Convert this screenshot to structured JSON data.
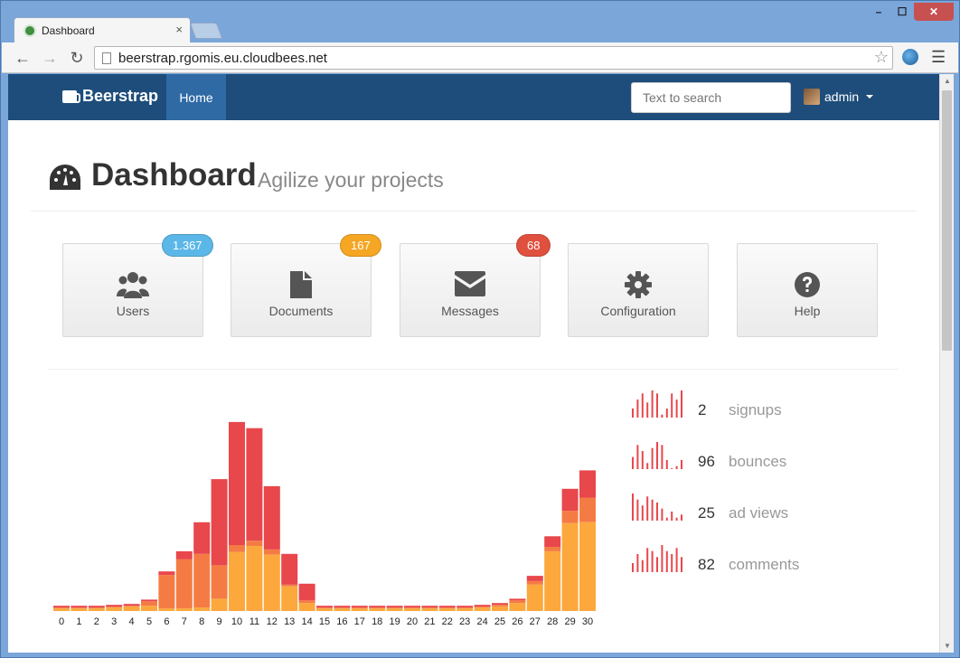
{
  "browser": {
    "tab_title": "Dashboard",
    "tab_close": "×",
    "url": "beerstrap.rgomis.eu.cloudbees.net",
    "window_controls": [
      "–",
      "☐",
      "✕"
    ]
  },
  "navbar": {
    "brand": "Beerstrap",
    "home_label": "Home",
    "search_placeholder": "Text to search",
    "user_name": "admin",
    "color": "#1e4d7b",
    "active_color": "#2f6aa5"
  },
  "header": {
    "title": "Dashboard",
    "subtitle": "Agilize your projects"
  },
  "tiles": [
    {
      "label": "Users",
      "icon": "users-icon",
      "badge": "1.367",
      "badge_color": "#5bb7e8"
    },
    {
      "label": "Documents",
      "icon": "document-icon",
      "badge": "167",
      "badge_color": "#f5a623"
    },
    {
      "label": "Messages",
      "icon": "envelope-icon",
      "badge": "68",
      "badge_color": "#e0503e"
    },
    {
      "label": "Configuration",
      "icon": "gear-icon",
      "badge": "",
      "badge_color": ""
    },
    {
      "label": "Help",
      "icon": "question-icon",
      "badge": "",
      "badge_color": ""
    }
  ],
  "stats": [
    {
      "value": "2",
      "label": "signups",
      "spark": [
        6,
        12,
        16,
        10,
        18,
        16,
        2,
        6,
        16,
        12,
        18
      ]
    },
    {
      "value": "96",
      "label": "bounces",
      "spark": [
        8,
        16,
        12,
        4,
        14,
        18,
        16,
        6,
        0,
        2,
        6
      ]
    },
    {
      "value": "25",
      "label": "ad views",
      "spark": [
        18,
        14,
        10,
        16,
        14,
        12,
        8,
        2,
        6,
        2,
        4
      ]
    },
    {
      "value": "82",
      "label": "comments",
      "spark": [
        6,
        12,
        8,
        16,
        14,
        10,
        18,
        14,
        12,
        16,
        10
      ]
    }
  ],
  "chart_data": {
    "type": "bar",
    "stacked": true,
    "categories": [
      "0",
      "1",
      "2",
      "3",
      "4",
      "5",
      "6",
      "7",
      "8",
      "9",
      "10",
      "11",
      "12",
      "13",
      "14",
      "15",
      "16",
      "17",
      "18",
      "19",
      "20",
      "21",
      "22",
      "23",
      "24",
      "25",
      "26",
      "27",
      "28",
      "29",
      "30"
    ],
    "series": [
      {
        "name": "",
        "color": "#fca83d",
        "values": [
          3,
          3,
          3,
          4,
          5,
          6,
          3,
          3,
          4,
          14,
          67,
          74,
          64,
          28,
          9,
          3,
          3,
          3,
          3,
          3,
          3,
          3,
          3,
          3,
          4,
          5,
          9,
          30,
          68,
          100,
          101
        ]
      },
      {
        "name": "",
        "color": "#f47c44",
        "values": [
          1,
          1,
          1,
          1,
          1,
          5,
          38,
          56,
          61,
          38,
          8,
          6,
          6,
          2,
          3,
          1,
          1,
          1,
          1,
          1,
          1,
          1,
          1,
          1,
          1,
          2,
          3,
          4,
          5,
          14,
          28
        ]
      },
      {
        "name": "",
        "color": "#e8474c",
        "values": [
          2,
          2,
          2,
          2,
          2,
          2,
          4,
          9,
          36,
          98,
          140,
          128,
          72,
          35,
          19,
          2,
          2,
          2,
          2,
          2,
          2,
          2,
          2,
          2,
          2,
          2,
          2,
          6,
          12,
          25,
          31
        ]
      }
    ],
    "ylim": [
      0,
      220
    ]
  }
}
